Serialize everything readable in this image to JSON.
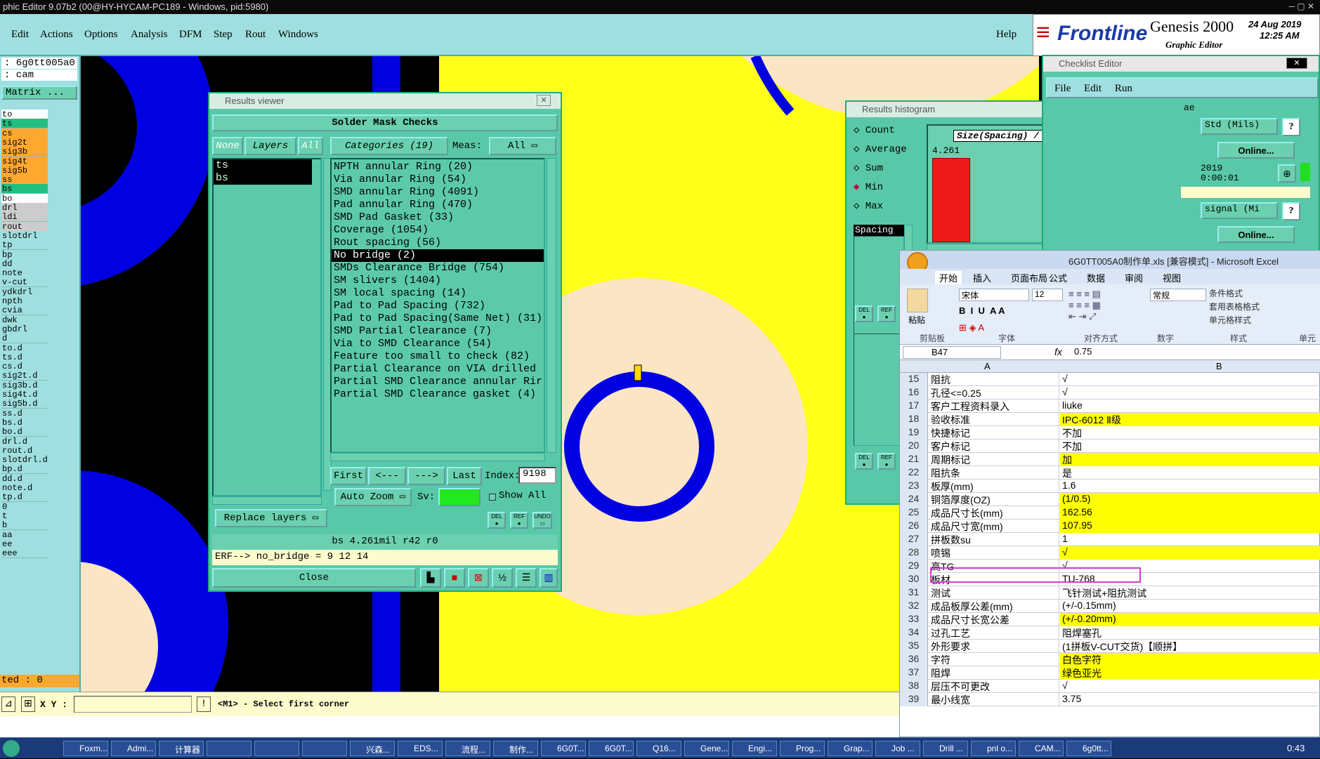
{
  "title_bar": "phic Editor 9.07b2 (00@HY-HYCAM-PC189 - Windows, pid:5980)",
  "menu": [
    "Edit",
    "Actions",
    "Options",
    "Analysis",
    "DFM",
    "Step",
    "Rout",
    "Windows"
  ],
  "help": "Help",
  "logo": {
    "brand": "Frontline",
    "product": "Genesis 2000",
    "subtitle": "Graphic Editor",
    "date": "24 Aug 2019",
    "time": "12:25 AM"
  },
  "left": {
    "job": ": 6g0tt005a0",
    "step": ": cam",
    "matrix": "Matrix ...",
    "layers": [
      "to",
      "ts",
      "cs",
      "sig2t",
      "sig3b",
      "sig4t",
      "sig5b",
      "ss",
      "bs",
      "bo",
      "drl",
      "ldi",
      "rout",
      "slotdrl",
      "tp",
      "bp",
      "dd",
      "note",
      "v-cut",
      "ydkdrl",
      "npth",
      "cvia",
      "dwk",
      "gbdrl",
      "d",
      "to.d",
      "ts.d",
      "cs.d",
      "sig2t.d",
      "sig3b.d",
      "sig4t.d",
      "sig5b.d",
      "ss.d",
      "bs.d",
      "bo.d",
      "drl.d",
      "rout.d",
      "slotdrl.d",
      "bp.d",
      "dd.d",
      "note.d",
      "tp.d",
      "0",
      "t",
      "b",
      "aa",
      "ee",
      "eee"
    ],
    "selected": "ted : 0"
  },
  "statusbar": {
    "xy_label": "X Y :",
    "message": "<M1> - Select first corner"
  },
  "results_viewer": {
    "title": "Results viewer",
    "header": "Solder Mask Checks",
    "none": "None",
    "layers": "Layers",
    "all": "All",
    "categories": "Categories (19)",
    "meas": "Meas:",
    "meas_val": "All",
    "layer_list": [
      "ts",
      "bs"
    ],
    "items": [
      "NPTH annular Ring (20)",
      "Via annular Ring (54)",
      "SMD annular Ring (4091)",
      "Pad annular Ring (470)",
      "SMD Pad Gasket (33)",
      "Coverage (1054)",
      "Rout spacing (56)",
      "No bridge (2)",
      "SMDs Clearance Bridge (754)",
      "SM slivers (1404)",
      "SM local spacing (14)",
      "Pad to Pad Spacing (732)",
      "Pad to Pad Spacing(Same Net) (31)",
      "SMD Partial Clearance (7)",
      "Via to SMD Clearance (54)",
      "Feature too small to check (82)",
      "Partial Clearance on VIA drilled",
      "Partial SMD Clearance annular Rir",
      "Partial SMD Clearance gasket (4)"
    ],
    "selected_index": 7,
    "first": "First",
    "prev": "<---",
    "next": "--->",
    "last": "Last",
    "index_label": "Index:",
    "index_val": "9198",
    "auto_zoom": "Auto Zoom",
    "sv": "Sv:",
    "show_all": "Show All",
    "replace": "Replace layers",
    "info": "bs 4.261mil  r42  r0",
    "erf": "ERF--> no_bridge = 9 12 14",
    "close": "Close",
    "del": "DEL",
    "ref": "REF",
    "undo": "UNDO"
  },
  "histogram": {
    "title": "Results histogram",
    "options": [
      "Count",
      "Average",
      "Sum",
      "Min",
      "Max"
    ],
    "selected": "Min",
    "field": "Spacing",
    "label": "Size(Spacing) / Min(Spacing)",
    "value": "4.261"
  },
  "checklist": {
    "title": "Checklist Editor",
    "menu": [
      "File",
      "Edit",
      "Run"
    ],
    "std": "Std (Mils)",
    "online": "Online...",
    "year": "2019",
    "time": "0:00:01",
    "signal": "signal (Mi",
    "ae": "ae"
  },
  "excel": {
    "title": "6G0TT005A0制作单.xls [兼容模式] - Microsoft Excel",
    "tabs": [
      "开始",
      "插入",
      "页面布局",
      "公式",
      "数据",
      "审阅",
      "视图"
    ],
    "font": "宋体",
    "size": "12",
    "format": "常规",
    "groups": [
      "剪贴板",
      "字体",
      "对齐方式",
      "数字",
      "样式",
      "单元"
    ],
    "styles": [
      "条件格式",
      "套用表格格式",
      "单元格样式"
    ],
    "paste": "粘贴",
    "cellref": "B47",
    "formula": "0.75",
    "colA": "A",
    "colB": "B",
    "rows": [
      {
        "n": "15",
        "a": "阻抗",
        "b": "√",
        "y": false
      },
      {
        "n": "16",
        "a": "孔径<=0.25",
        "b": "√",
        "y": false
      },
      {
        "n": "17",
        "a": "客户工程资料录入",
        "b": "liuke",
        "y": false
      },
      {
        "n": "18",
        "a": "验收标准",
        "b": "IPC-6012 Ⅱ级",
        "y": true
      },
      {
        "n": "19",
        "a": "快捷标记",
        "b": "不加",
        "y": false
      },
      {
        "n": "20",
        "a": "客户标记",
        "b": "不加",
        "y": false
      },
      {
        "n": "21",
        "a": "周期标记",
        "b": "加",
        "y": true
      },
      {
        "n": "22",
        "a": "阻抗条",
        "b": "是",
        "y": false
      },
      {
        "n": "23",
        "a": "板厚(mm)",
        "b": "1.6",
        "y": false
      },
      {
        "n": "24",
        "a": "铜箔厚度(OZ)",
        "b": "(1/0.5)",
        "y": true
      },
      {
        "n": "25",
        "a": "成品尺寸长(mm)",
        "b": "162.56",
        "y": true
      },
      {
        "n": "26",
        "a": "成品尺寸宽(mm)",
        "b": "107.95",
        "y": true
      },
      {
        "n": "27",
        "a": "拼板数su",
        "b": "1",
        "y": false
      },
      {
        "n": "28",
        "a": "喷锡",
        "b": "√",
        "y": true
      },
      {
        "n": "29",
        "a": "高TG",
        "b": "√",
        "y": false
      },
      {
        "n": "30",
        "a": "板材",
        "b": "TU-768",
        "y": false
      },
      {
        "n": "31",
        "a": "测试",
        "b": "飞针测试+阻抗测试",
        "y": false
      },
      {
        "n": "32",
        "a": "成品板厚公差(mm)",
        "b": "(+/-0.15mm)",
        "y": false
      },
      {
        "n": "33",
        "a": "成品尺寸长宽公差",
        "b": "(+/-0.20mm)",
        "y": true
      },
      {
        "n": "34",
        "a": "过孔工艺",
        "b": "阻焊塞孔",
        "y": false
      },
      {
        "n": "35",
        "a": "外形要求",
        "b": "(1拼板V-CUT交货)【顺拼】",
        "y": false
      },
      {
        "n": "36",
        "a": "字符",
        "b": "白色字符",
        "y": true
      },
      {
        "n": "37",
        "a": "阻焊",
        "b": "绿色亚光",
        "y": true
      },
      {
        "n": "38",
        "a": "层压不可更改",
        "b": "√",
        "y": false
      },
      {
        "n": "39",
        "a": "最小线宽",
        "b": "3.75",
        "y": false
      }
    ]
  },
  "taskbar": [
    "Foxm...",
    "Admi...",
    "计算器",
    "",
    "",
    "",
    "兴森...",
    "EDS...",
    "流程...",
    "制作...",
    "6G0T...",
    "6G0T...",
    "Q16...",
    "Gene...",
    "Engi...",
    "Prog...",
    "Grap...",
    "Job ...",
    "Drill ...",
    "pnl o...",
    "CAM...",
    "6g0tt..."
  ],
  "clock": "0:43"
}
